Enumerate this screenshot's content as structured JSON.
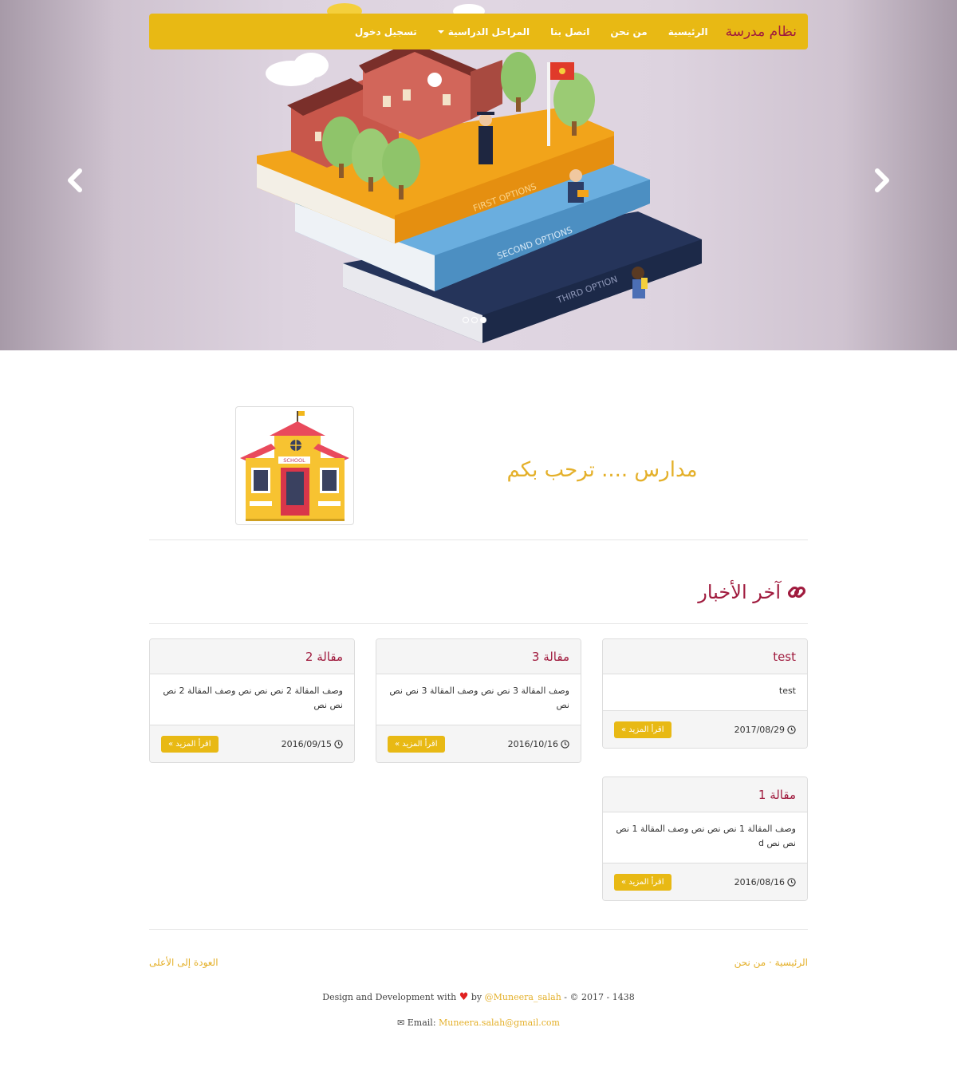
{
  "nav": {
    "brand": "نظام مدرسة",
    "items": [
      "الرئيسية",
      "من نحن",
      "اتصل بنا",
      "المراحل الدراسية",
      "تسجيل دخول"
    ]
  },
  "carousel": {
    "book_labels": [
      "FIRST OPTIONS",
      "SECOND OPTIONS",
      "THIRD OPTION"
    ],
    "slide_count": 3,
    "active_slide": 3
  },
  "welcome": {
    "title": "مدارس .... ترحب بكم",
    "image_sign": "SCHOOL"
  },
  "news": {
    "heading": "آخر الأخبار",
    "read_more": "اقرأ المزيد »",
    "articles": [
      {
        "title": "test",
        "body": "test",
        "date": "2017/08/29"
      },
      {
        "title": "مقالة 3",
        "body": "وصف المقالة 3 نص نص وصف المقالة 3 نص نص نص",
        "date": "2016/10/16"
      },
      {
        "title": "مقالة 2",
        "body": "وصف المقالة 2 نص نص نص وصف المقالة 2 نص نص نص",
        "date": "2016/09/15"
      },
      {
        "title": "مقالة 1",
        "body": "وصف المقالة 1 نص نص نص  وصف المقالة 1 نص نص نص  d",
        "date": "2016/08/16"
      }
    ]
  },
  "footer": {
    "home": "الرئيسية",
    "separator": "·",
    "about": "من نحن",
    "back_to_top": "العودة إلى الأعلى",
    "credit_prefix": "Design and Development with",
    "credit_by": "by",
    "credit_handle": "@Muneera_salah",
    "credit_suffix": "- © 2017 - 1438",
    "email_label": "Email:",
    "email": "Muneera.salah@gmail.com"
  },
  "colors": {
    "accent": "#e8b914",
    "brand": "#a01b3e",
    "gold_text": "#e4b02a"
  }
}
